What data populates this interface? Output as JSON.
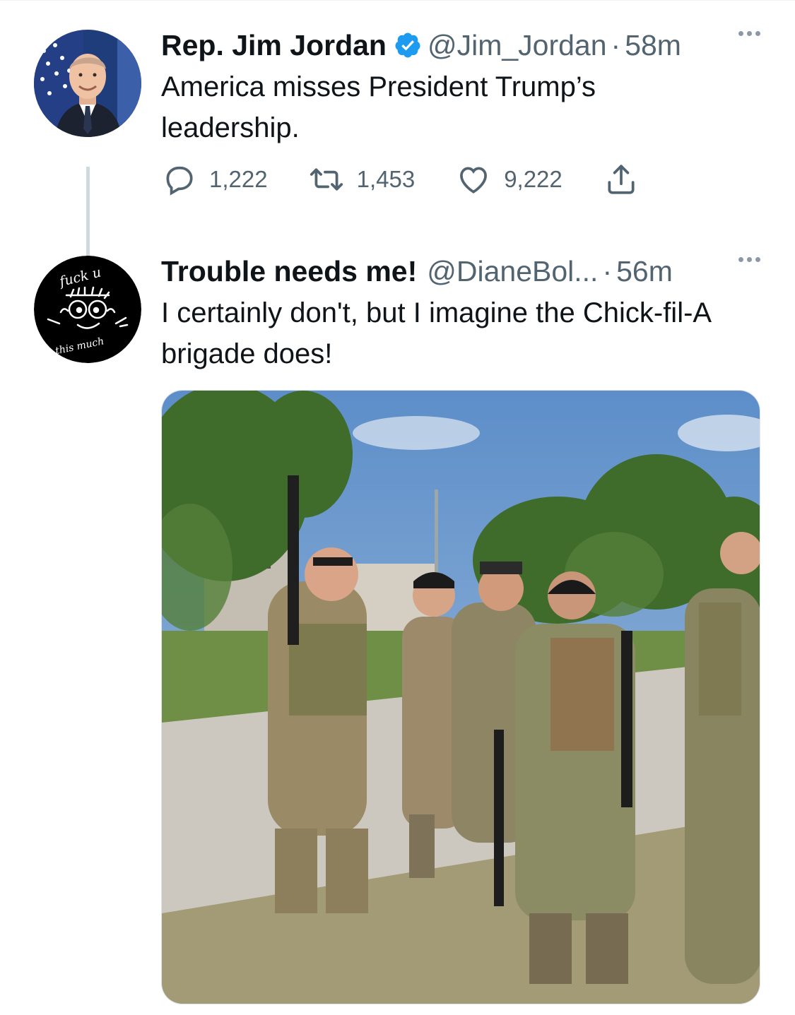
{
  "tweets": [
    {
      "display_name": "Rep. Jim Jordan",
      "verified": true,
      "handle": "@Jim_Jordan",
      "separator": "·",
      "time": "58m",
      "text": "America misses President Trump’s leadership.",
      "stats": {
        "replies": "1,222",
        "retweets": "1,453",
        "likes": "9,222"
      },
      "avatar_icon": "portrait-flag-avatar"
    },
    {
      "display_name": "Trouble needs me!",
      "verified": false,
      "handle": "@DianeBol...",
      "separator": "·",
      "time": "56m",
      "text": "I certainly don't, but I imagine the Chick-fil-A brigade does!",
      "avatar_icon": "hand-drawn-face-avatar",
      "avatar_text": {
        "top": "fuck u",
        "bottom": "this much"
      },
      "media_icon": "soldiers-photo"
    }
  ],
  "colors": {
    "secondary": "#536471",
    "verified": "#1d9bf0",
    "thread_line": "#cfd9de"
  }
}
